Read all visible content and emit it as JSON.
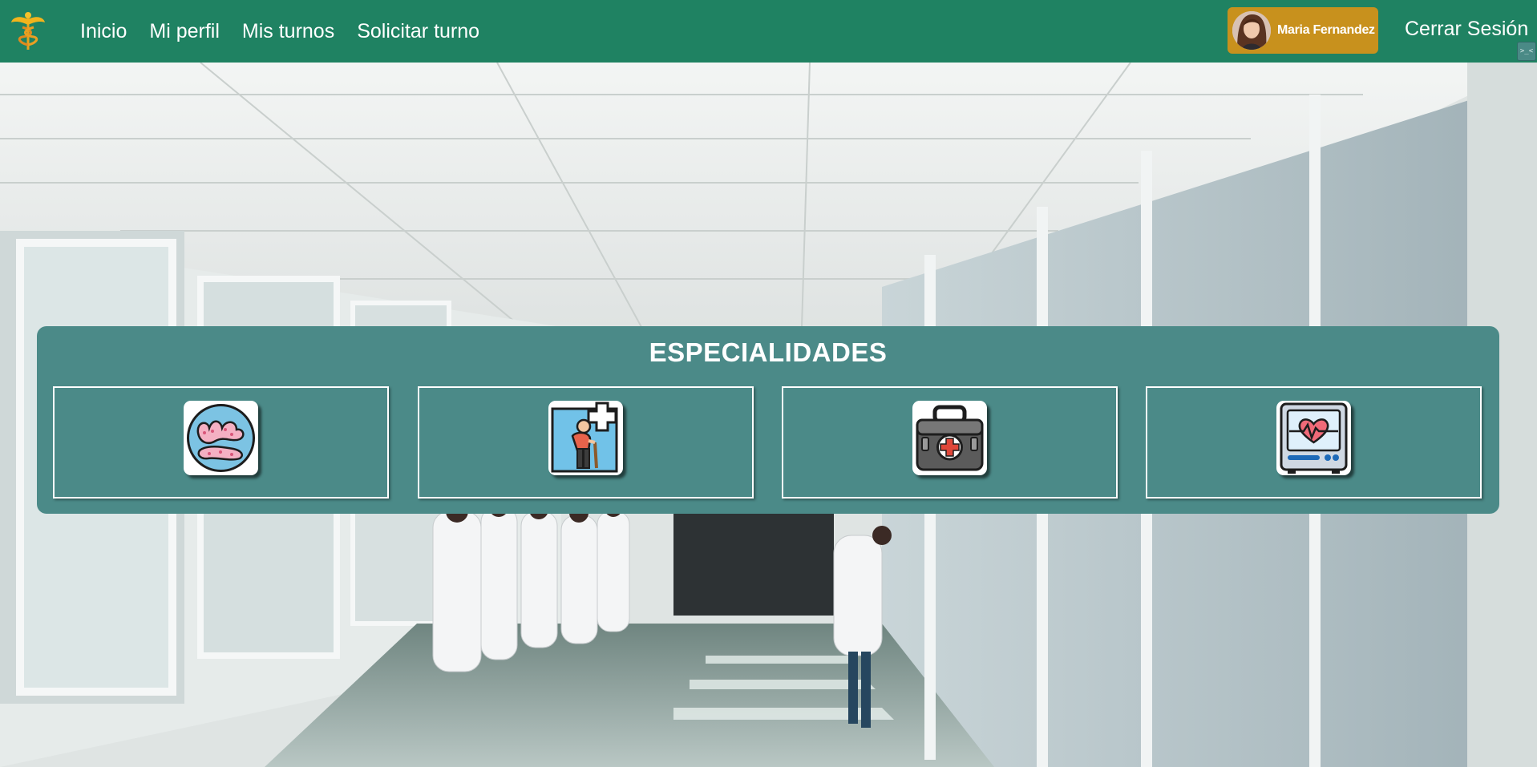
{
  "nav": {
    "logo_icon": "caduceus-icon",
    "links": [
      "Inicio",
      "Mi perfil",
      "Mis turnos",
      "Solicitar turno"
    ],
    "user_name": "Maria Fernandez",
    "logout_label": "Cerrar Sesión"
  },
  "specialties": {
    "title": "ESPECIALIDADES",
    "items": [
      {
        "icon": "endocrine-glands-icon"
      },
      {
        "icon": "elderly-care-icon"
      },
      {
        "icon": "medical-kit-icon"
      },
      {
        "icon": "heart-monitor-icon"
      }
    ]
  },
  "colors": {
    "navbar": "#1f8262",
    "user_chip": "#c8911d",
    "panel": "#4b8a88"
  }
}
